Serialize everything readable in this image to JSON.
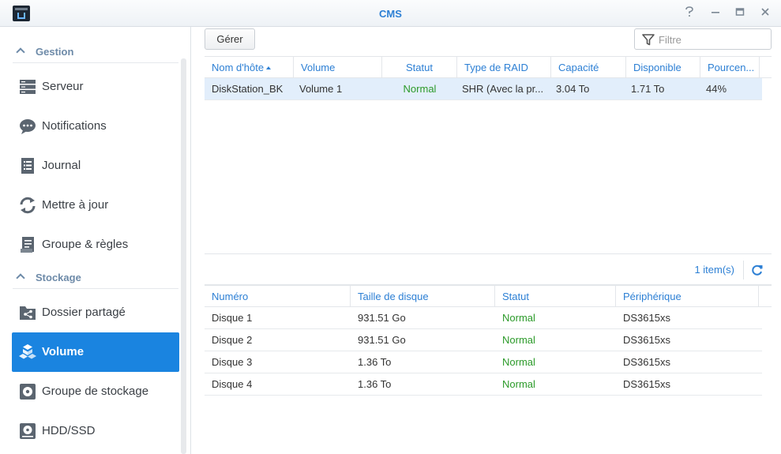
{
  "window": {
    "title": "CMS",
    "controls": [
      "help-icon",
      "minimize-icon",
      "maximize-icon",
      "close-icon"
    ]
  },
  "sidebar": {
    "sections": [
      {
        "label": "Gestion"
      },
      {
        "label": "Stockage"
      }
    ],
    "items": [
      {
        "label": "Serveur",
        "icon": "server-icon"
      },
      {
        "label": "Notifications",
        "icon": "chat-icon"
      },
      {
        "label": "Journal",
        "icon": "log-icon"
      },
      {
        "label": "Mettre à jour",
        "icon": "update-icon"
      },
      {
        "label": "Groupe & règles",
        "icon": "policy-icon"
      },
      {
        "label": "Dossier partagé",
        "icon": "shared-folder-icon"
      },
      {
        "label": "Volume",
        "icon": "volume-icon",
        "active": true
      },
      {
        "label": "Groupe de stockage",
        "icon": "storage-pool-icon"
      },
      {
        "label": "HDD/SSD",
        "icon": "hdd-icon"
      }
    ]
  },
  "toolbar": {
    "manage_label": "Gérer",
    "filter_placeholder": "Filtre"
  },
  "volumes": {
    "columns": [
      "Nom d'hôte",
      "Volume",
      "Statut",
      "Type de RAID",
      "Capacité",
      "Disponible",
      "Pourcen..."
    ],
    "sort_column": "Nom d'hôte",
    "rows": [
      {
        "host": "DiskStation_BK",
        "volume": "Volume 1",
        "status": "Normal",
        "raid": "SHR (Avec la pr...",
        "capacity": "3.04 To",
        "available": "1.71 To",
        "percent": "44%"
      }
    ],
    "item_count": "1 item(s)"
  },
  "disks": {
    "columns": [
      "Numéro",
      "Taille de disque",
      "Statut",
      "Périphérique"
    ],
    "rows": [
      {
        "number": "Disque 1",
        "size": "931.51 Go",
        "status": "Normal",
        "device": "DS3615xs"
      },
      {
        "number": "Disque 2",
        "size": "931.51 Go",
        "status": "Normal",
        "device": "DS3615xs"
      },
      {
        "number": "Disque 3",
        "size": "1.36 To",
        "status": "Normal",
        "device": "DS3615xs"
      },
      {
        "number": "Disque 4",
        "size": "1.36 To",
        "status": "Normal",
        "device": "DS3615xs"
      }
    ]
  },
  "colors": {
    "accent": "#2c7fd4",
    "active_nav": "#1a84e0",
    "status_normal": "#2b9a29",
    "selected_row": "#e2eefb"
  }
}
